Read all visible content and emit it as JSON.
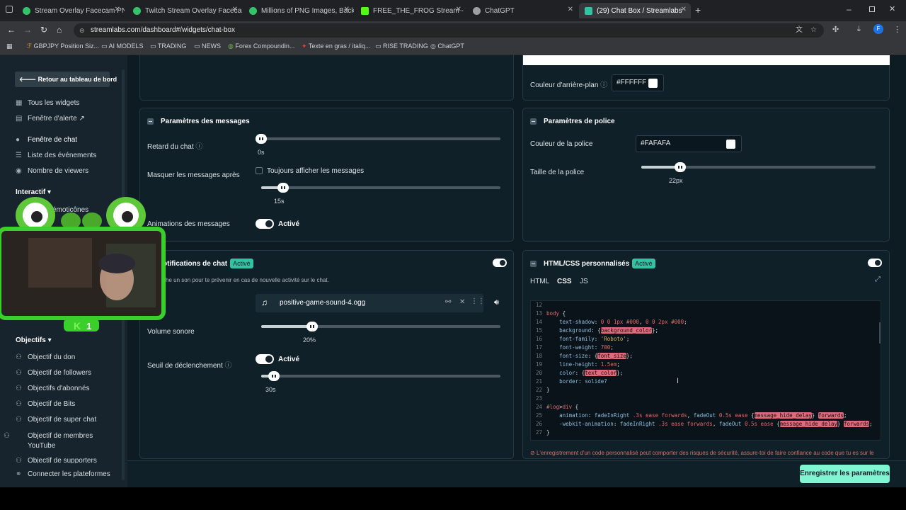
{
  "browser": {
    "tabs": [
      {
        "title": "Stream Overlay Facecam PNG, V",
        "color": "#33c46b"
      },
      {
        "title": "Twitch Stream Overlay Facecam",
        "color": "#33c46b"
      },
      {
        "title": "Millions of PNG Images, Backgr",
        "color": "#33c46b"
      },
      {
        "title": "FREE_THE_FROG Stream - Watc",
        "color": "#53fc18"
      },
      {
        "title": "ChatGPT",
        "color": "#9aa0a6"
      },
      {
        "title": "(29) Chat Box / Streamlabs",
        "color": "#31c3a2"
      }
    ],
    "url": "streamlabs.com/dashboard#/widgets/chat-box",
    "bookmarks": [
      "GBPJPY Position Siz...",
      "AI MODELS",
      "TRADING",
      "NEWS",
      "Forex Compoundin...",
      "Texte en gras / italiq...",
      "RISE TRADING",
      "ChatGPT"
    ],
    "profile_initial": "F"
  },
  "sidebar": {
    "back_button": "Retour au tableau de bord",
    "items": [
      {
        "label": "Tous les widgets",
        "icon": "grid-icon"
      },
      {
        "label": "Fenêtre d'alerte",
        "icon": "alert-icon"
      },
      {
        "label": "Fenêtre de chat",
        "icon": "chat-icon"
      },
      {
        "label": "Liste des événements",
        "icon": "list-icon"
      },
      {
        "label": "Nombre de viewers",
        "icon": "eye-icon"
      }
    ],
    "interactive_header": "Interactif",
    "emotes_item": "émoticônes",
    "goals_header": "Objectifs",
    "goals": [
      "Objectif du don",
      "Objectif de followers",
      "Objectifs d'abonnés",
      "Objectif de Bits",
      "Objectif de super chat",
      "Objectif de membres YouTube",
      "Objectif de supporters"
    ],
    "connect": "Connecter les plateformes"
  },
  "background": {
    "label": "Couleur d'arrière-plan",
    "value": "#FFFFFF"
  },
  "messages": {
    "title": "Paramètres des messages",
    "chat_delay_label": "Retard du chat",
    "chat_delay_value": "0s",
    "chat_delay_fraction": 0.0,
    "hide_after_label": "Masquer les messages après",
    "always_show_label": "Toujours afficher les messages",
    "hide_value": "15s",
    "hide_fraction": 0.07,
    "animations_label": "Animations des messages",
    "animations_state": "Activé"
  },
  "font": {
    "title": "Paramètres de police",
    "color_label": "Couleur de la police",
    "color_value": "#FAFAFA",
    "size_label": "Taille de la police",
    "size_value": "22px",
    "size_fraction": 0.15
  },
  "notifications": {
    "title": "otifications de chat",
    "badge": "Activé",
    "description": "che un son pour te prévenir en cas de nouvelle activité sur le chat.",
    "sound_file": "positive-game-sound-4.ogg",
    "volume_label": "Volume sonore",
    "volume_value": "20%",
    "volume_fraction": 0.2,
    "threshold_label": "Seuil de déclenchement",
    "threshold_state": "Activé",
    "threshold_value": "30s",
    "threshold_fraction": 0.03
  },
  "custom": {
    "title": "HTML/CSS personnalisés",
    "badge": "Activé",
    "tabs": [
      "HTML",
      "CSS",
      "JS"
    ],
    "active_tab": "CSS",
    "warning": "L'enregistrement d'un code personnalisé peut comporter des risques de sécurité, assure-toi de faire confiance au code que tu es sur le"
  },
  "save_button": "Enregistrer les paramètres",
  "webcam": {
    "badge": "1"
  }
}
